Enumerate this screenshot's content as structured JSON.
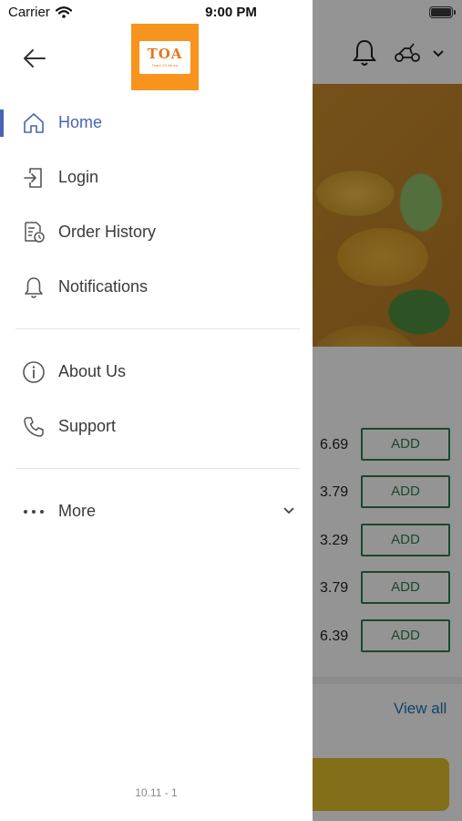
{
  "status_bar": {
    "carrier": "Carrier",
    "time": "9:00 PM"
  },
  "logo": {
    "text": "TOA",
    "subtitle": "Taste Of Africa"
  },
  "menu": {
    "home": "Home",
    "login": "Login",
    "order_history": "Order History",
    "notifications": "Notifications",
    "about_us": "About Us",
    "support": "Support",
    "more": "More"
  },
  "version": "10.11 - 1",
  "background": {
    "prices": [
      "6.69",
      "3.79",
      "3.29",
      "3.79",
      "6.39"
    ],
    "add_label": "ADD",
    "view_all": "View all"
  },
  "colors": {
    "accent": "#4a63b5",
    "logo_bg": "#f7941d",
    "add_green": "#2e7d4f",
    "cart_yellow": "#e2bd2b"
  }
}
